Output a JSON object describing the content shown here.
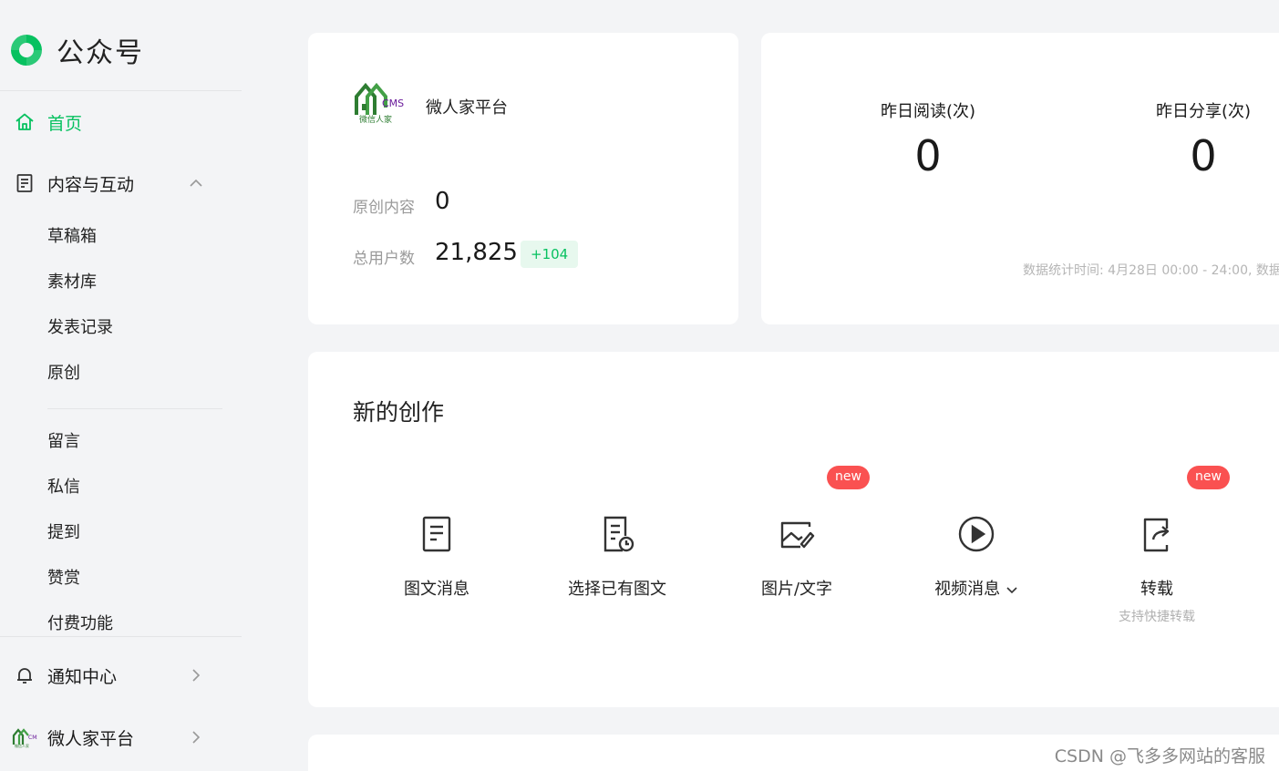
{
  "brand": {
    "name": "公众号",
    "accent": "#07c160"
  },
  "nav": {
    "home": "首页",
    "content_group": "内容与互动",
    "content_items": [
      "草稿箱",
      "素材库",
      "发表记录",
      "原创"
    ],
    "interaction_items": [
      "留言",
      "私信",
      "提到",
      "赞赏",
      "付费功能"
    ],
    "notifications": "通知中心",
    "account": "微人家平台"
  },
  "account_card": {
    "logo_text": "微信人家",
    "logo_badge": "CMS",
    "name": "微人家平台",
    "original_label": "原创内容",
    "original_value": "0",
    "users_label": "总用户数",
    "users_value": "21,825",
    "users_delta": "+104"
  },
  "stats": {
    "reads_label": "昨日阅读(次)",
    "reads_value": "0",
    "shares_label": "昨日分享(次)",
    "shares_value": "0",
    "note": "数据统计时间: 4月28日 00:00 - 24:00, 数据"
  },
  "create": {
    "title": "新的创作",
    "new_badge": "new",
    "tools": [
      {
        "label": "图文消息",
        "icon": "document-icon"
      },
      {
        "label": "选择已有图文",
        "icon": "document-clock-icon"
      },
      {
        "label": "图片/文字",
        "icon": "image-edit-icon"
      },
      {
        "label": "视频消息",
        "icon": "play-circle-icon"
      },
      {
        "label": "转载",
        "sub": "支持快捷转载",
        "icon": "repost-icon"
      }
    ]
  },
  "watermark": "CSDN @飞多多网站的客服"
}
